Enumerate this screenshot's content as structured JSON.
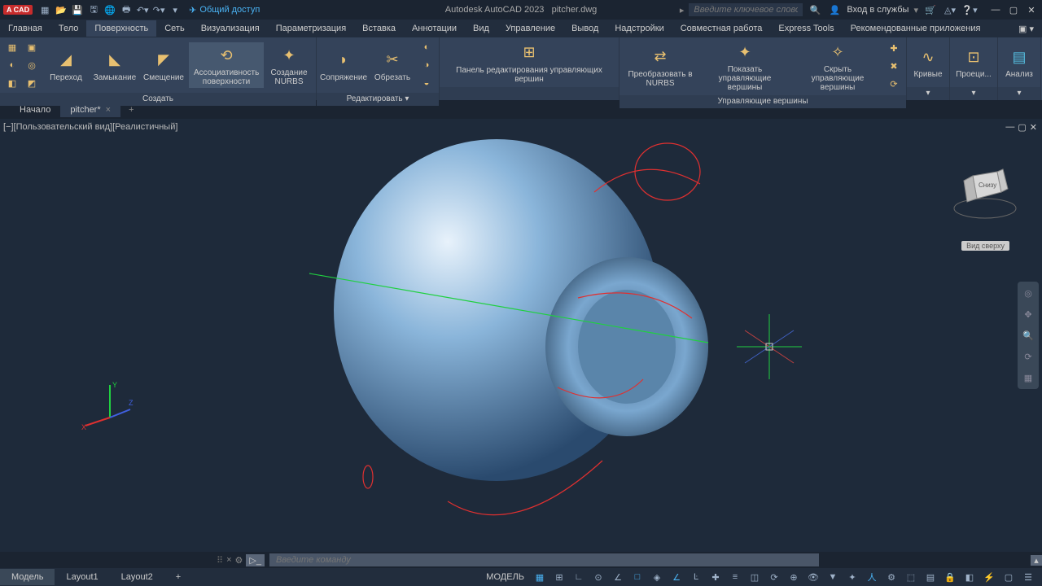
{
  "title": {
    "app": "Autodesk AutoCAD 2023",
    "file": "pitcher.dwg",
    "badge": "A CAD"
  },
  "share": "Общий доступ",
  "search_placeholder": "Введите ключевое слово/фразу",
  "signin": "Вход в службы",
  "menu": [
    "Главная",
    "Тело",
    "Поверхность",
    "Сеть",
    "Визуализация",
    "Параметризация",
    "Вставка",
    "Аннотации",
    "Вид",
    "Управление",
    "Вывод",
    "Надстройки",
    "Совместная работа",
    "Express Tools",
    "Рекомендованные приложения"
  ],
  "menu_active": 2,
  "ribbon": {
    "panels": [
      {
        "title": "Создать",
        "buttons": [
          "Переход",
          "Замыкание",
          "Смещение"
        ],
        "highlighted": "Ассоциативность поверхности",
        "extra": "Создание NURBS"
      },
      {
        "title": "Редактировать ▾",
        "buttons": [
          "Сопряжение",
          "Обрезать"
        ]
      },
      {
        "title": "",
        "big": "Панель редактирования управляющих вершин"
      },
      {
        "title": "Управляющие вершины",
        "buttons_multi": [
          "Преобразовать в NURBS",
          "Показать управляющие вершины",
          "Скрыть управляющие вершины"
        ]
      },
      {
        "title": "▾",
        "label": "Кривые"
      },
      {
        "title": "▾",
        "label": "Проеци..."
      },
      {
        "title": "▾",
        "label": "Анализ"
      }
    ]
  },
  "filetabs": {
    "start": "Начало",
    "active": "pitcher*"
  },
  "viewport": {
    "label": "[−][Пользовательский вид][Реалистичный]",
    "wcs": "Вид сверху",
    "cube_face": "Снизу"
  },
  "cmdline": {
    "placeholder": "Введите команду"
  },
  "model_tabs": [
    "Модель",
    "Layout1",
    "Layout2"
  ],
  "status_label": "МОДЕЛЬ"
}
